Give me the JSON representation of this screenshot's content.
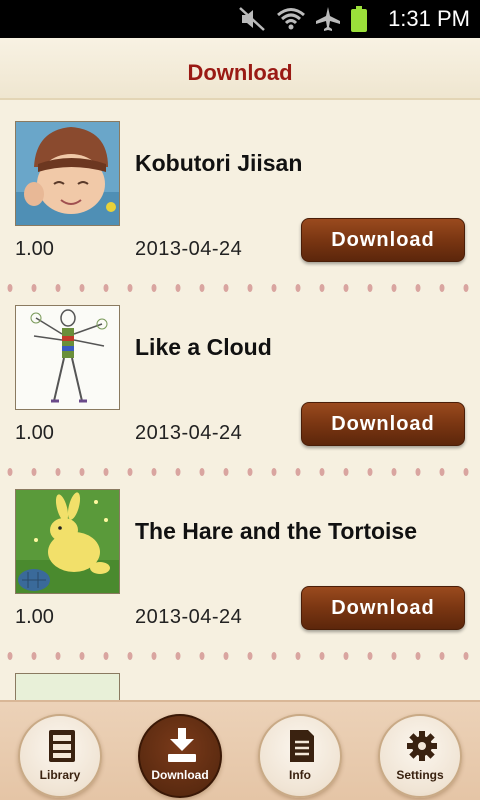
{
  "status_bar": {
    "time": "1:31 PM",
    "icons": [
      "mute-icon",
      "wifi-icon",
      "airplane-icon",
      "battery-icon"
    ]
  },
  "header": {
    "title": "Download"
  },
  "items": [
    {
      "title": "Kobutori Jiisan",
      "version": "1.00",
      "date": "2013-04-24",
      "button_label": "Download",
      "thumb": "old-man-illustration"
    },
    {
      "title": "Like a Cloud",
      "version": "1.00",
      "date": "2013-04-24",
      "button_label": "Download",
      "thumb": "figure-sketch-illustration"
    },
    {
      "title": "The Hare and the Tortoise",
      "version": "1.00",
      "date": "2013-04-24",
      "button_label": "Download",
      "thumb": "hare-illustration"
    }
  ],
  "nav": [
    {
      "label": "Library",
      "icon": "library-icon",
      "active": false
    },
    {
      "label": "Download",
      "icon": "download-icon",
      "active": true
    },
    {
      "label": "Info",
      "icon": "info-icon",
      "active": false
    },
    {
      "label": "Settings",
      "icon": "gear-icon",
      "active": false
    }
  ],
  "colors": {
    "title_red": "#9a1a14",
    "button_brown": "#7a3612",
    "background": "#f6f0e0"
  }
}
